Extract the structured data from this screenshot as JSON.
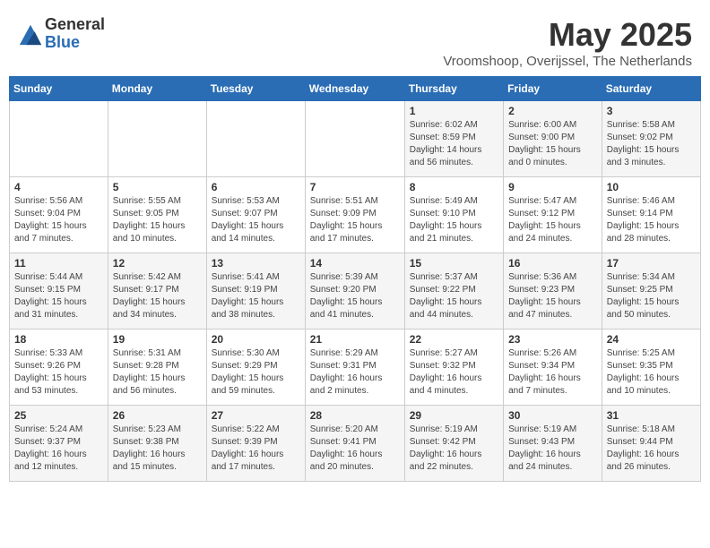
{
  "header": {
    "logo_general": "General",
    "logo_blue": "Blue",
    "month_title": "May 2025",
    "subtitle": "Vroomshoop, Overijssel, The Netherlands"
  },
  "weekdays": [
    "Sunday",
    "Monday",
    "Tuesday",
    "Wednesday",
    "Thursday",
    "Friday",
    "Saturday"
  ],
  "weeks": [
    [
      {
        "day": "",
        "info": ""
      },
      {
        "day": "",
        "info": ""
      },
      {
        "day": "",
        "info": ""
      },
      {
        "day": "",
        "info": ""
      },
      {
        "day": "1",
        "info": "Sunrise: 6:02 AM\nSunset: 8:59 PM\nDaylight: 14 hours\nand 56 minutes."
      },
      {
        "day": "2",
        "info": "Sunrise: 6:00 AM\nSunset: 9:00 PM\nDaylight: 15 hours\nand 0 minutes."
      },
      {
        "day": "3",
        "info": "Sunrise: 5:58 AM\nSunset: 9:02 PM\nDaylight: 15 hours\nand 3 minutes."
      }
    ],
    [
      {
        "day": "4",
        "info": "Sunrise: 5:56 AM\nSunset: 9:04 PM\nDaylight: 15 hours\nand 7 minutes."
      },
      {
        "day": "5",
        "info": "Sunrise: 5:55 AM\nSunset: 9:05 PM\nDaylight: 15 hours\nand 10 minutes."
      },
      {
        "day": "6",
        "info": "Sunrise: 5:53 AM\nSunset: 9:07 PM\nDaylight: 15 hours\nand 14 minutes."
      },
      {
        "day": "7",
        "info": "Sunrise: 5:51 AM\nSunset: 9:09 PM\nDaylight: 15 hours\nand 17 minutes."
      },
      {
        "day": "8",
        "info": "Sunrise: 5:49 AM\nSunset: 9:10 PM\nDaylight: 15 hours\nand 21 minutes."
      },
      {
        "day": "9",
        "info": "Sunrise: 5:47 AM\nSunset: 9:12 PM\nDaylight: 15 hours\nand 24 minutes."
      },
      {
        "day": "10",
        "info": "Sunrise: 5:46 AM\nSunset: 9:14 PM\nDaylight: 15 hours\nand 28 minutes."
      }
    ],
    [
      {
        "day": "11",
        "info": "Sunrise: 5:44 AM\nSunset: 9:15 PM\nDaylight: 15 hours\nand 31 minutes."
      },
      {
        "day": "12",
        "info": "Sunrise: 5:42 AM\nSunset: 9:17 PM\nDaylight: 15 hours\nand 34 minutes."
      },
      {
        "day": "13",
        "info": "Sunrise: 5:41 AM\nSunset: 9:19 PM\nDaylight: 15 hours\nand 38 minutes."
      },
      {
        "day": "14",
        "info": "Sunrise: 5:39 AM\nSunset: 9:20 PM\nDaylight: 15 hours\nand 41 minutes."
      },
      {
        "day": "15",
        "info": "Sunrise: 5:37 AM\nSunset: 9:22 PM\nDaylight: 15 hours\nand 44 minutes."
      },
      {
        "day": "16",
        "info": "Sunrise: 5:36 AM\nSunset: 9:23 PM\nDaylight: 15 hours\nand 47 minutes."
      },
      {
        "day": "17",
        "info": "Sunrise: 5:34 AM\nSunset: 9:25 PM\nDaylight: 15 hours\nand 50 minutes."
      }
    ],
    [
      {
        "day": "18",
        "info": "Sunrise: 5:33 AM\nSunset: 9:26 PM\nDaylight: 15 hours\nand 53 minutes."
      },
      {
        "day": "19",
        "info": "Sunrise: 5:31 AM\nSunset: 9:28 PM\nDaylight: 15 hours\nand 56 minutes."
      },
      {
        "day": "20",
        "info": "Sunrise: 5:30 AM\nSunset: 9:29 PM\nDaylight: 15 hours\nand 59 minutes."
      },
      {
        "day": "21",
        "info": "Sunrise: 5:29 AM\nSunset: 9:31 PM\nDaylight: 16 hours\nand 2 minutes."
      },
      {
        "day": "22",
        "info": "Sunrise: 5:27 AM\nSunset: 9:32 PM\nDaylight: 16 hours\nand 4 minutes."
      },
      {
        "day": "23",
        "info": "Sunrise: 5:26 AM\nSunset: 9:34 PM\nDaylight: 16 hours\nand 7 minutes."
      },
      {
        "day": "24",
        "info": "Sunrise: 5:25 AM\nSunset: 9:35 PM\nDaylight: 16 hours\nand 10 minutes."
      }
    ],
    [
      {
        "day": "25",
        "info": "Sunrise: 5:24 AM\nSunset: 9:37 PM\nDaylight: 16 hours\nand 12 minutes."
      },
      {
        "day": "26",
        "info": "Sunrise: 5:23 AM\nSunset: 9:38 PM\nDaylight: 16 hours\nand 15 minutes."
      },
      {
        "day": "27",
        "info": "Sunrise: 5:22 AM\nSunset: 9:39 PM\nDaylight: 16 hours\nand 17 minutes."
      },
      {
        "day": "28",
        "info": "Sunrise: 5:20 AM\nSunset: 9:41 PM\nDaylight: 16 hours\nand 20 minutes."
      },
      {
        "day": "29",
        "info": "Sunrise: 5:19 AM\nSunset: 9:42 PM\nDaylight: 16 hours\nand 22 minutes."
      },
      {
        "day": "30",
        "info": "Sunrise: 5:19 AM\nSunset: 9:43 PM\nDaylight: 16 hours\nand 24 minutes."
      },
      {
        "day": "31",
        "info": "Sunrise: 5:18 AM\nSunset: 9:44 PM\nDaylight: 16 hours\nand 26 minutes."
      }
    ]
  ]
}
